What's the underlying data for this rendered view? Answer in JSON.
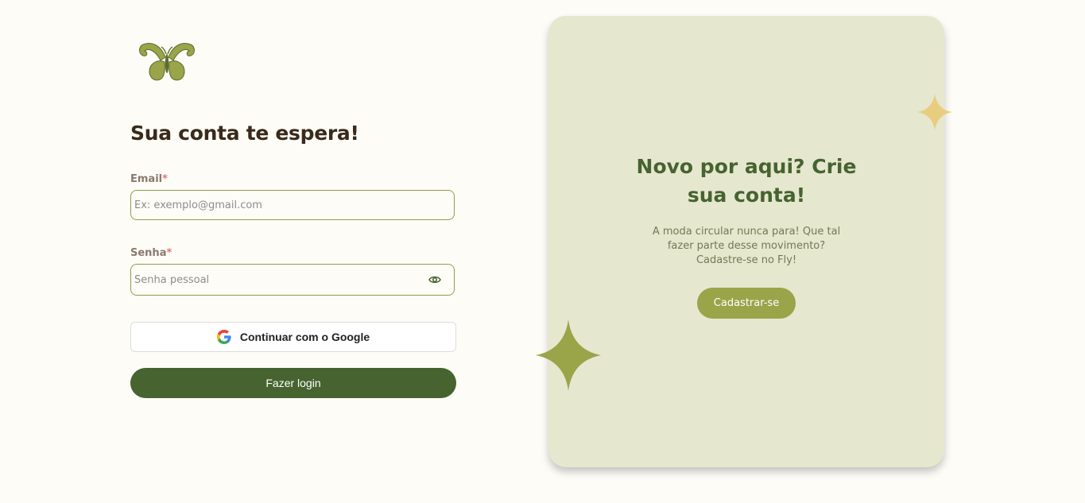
{
  "login": {
    "title": "Sua conta te espera!",
    "email": {
      "label": "Email",
      "required_mark": "*",
      "placeholder": "Ex: exemplo@gmail.com",
      "value": ""
    },
    "password": {
      "label": "Senha",
      "required_mark": "*",
      "placeholder": "Senha pessoal",
      "value": "",
      "toggle_icon": "eye-icon"
    },
    "google_button_label": "Continuar com o Google",
    "login_button_label": "Fazer login"
  },
  "promo": {
    "title_lines": [
      "Novo por aqui? Crie",
      "sua conta!"
    ],
    "text_lines": [
      "A moda circular nunca para! Que tal",
      "fazer parte desse movimento?",
      "Cadastre-se no Fly!"
    ],
    "signup_button_label": "Cadastrar-se"
  },
  "colors": {
    "page_background": "#fdfcf7",
    "primary_green": "#466330",
    "olive": "#9aa449",
    "card_background": "#e6e7cf",
    "sparkle_gold": "#e8cd7e",
    "title_brown": "#3a2a1c",
    "required_red": "#e57373"
  },
  "icons": {
    "logo": "butterfly-logo",
    "google": "google-g-icon",
    "password_toggle": "eye-icon",
    "decor": [
      "sparkle-icon",
      "sparkle-icon"
    ]
  }
}
